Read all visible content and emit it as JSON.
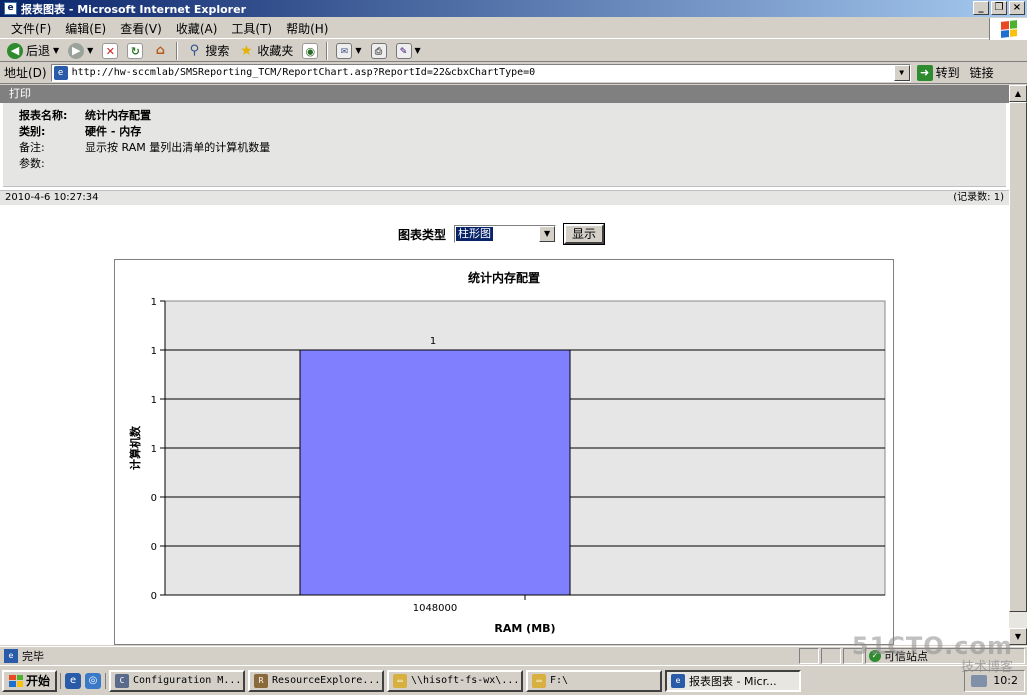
{
  "window": {
    "title": "报表图表 - Microsoft Internet Explorer"
  },
  "menu": [
    "文件(F)",
    "编辑(E)",
    "查看(V)",
    "收藏(A)",
    "工具(T)",
    "帮助(H)"
  ],
  "toolbar": {
    "back_label": "后退",
    "search_label": "搜索",
    "favorites_label": "收藏夹"
  },
  "address": {
    "label": "地址(D)",
    "url": "http://hw-sccmlab/SMSReporting_TCM/ReportChart.asp?ReportId=22&cbxChartType=0",
    "go_label": "转到",
    "links_label": "链接"
  },
  "report": {
    "print_label": "打印",
    "name_key": "报表名称:",
    "name_value": "统计内存配置",
    "category_key": "类别:",
    "category_value": "硬件 - 内存",
    "comment_key": "备注:",
    "comment_value": "显示按 RAM 量列出清单的计算机数量",
    "params_key": "参数:",
    "timestamp": "2010-4-6 10:27:34",
    "record_count": "(记录数: 1)",
    "chart_type_label": "图表类型",
    "chart_type_value": "柱形图",
    "show_button": "显示"
  },
  "chart_data": {
    "type": "bar",
    "title": "统计内存配置",
    "xlabel": "RAM (MB)",
    "ylabel": "计算机数",
    "categories": [
      "1048000"
    ],
    "values": [
      1
    ],
    "ytick_labels": [
      "0",
      "0",
      "0",
      "1",
      "1",
      "1",
      "1"
    ],
    "ylim": [
      0,
      1.2
    ],
    "data_labels": [
      "1"
    ],
    "grid": true,
    "plot_background": "#e6e6e6",
    "bar_color": "#8080ff",
    "legend": "none"
  },
  "status": {
    "text": "完毕",
    "zone": "可信站点"
  },
  "taskbar": {
    "start_label": "开始",
    "tasks": [
      {
        "label": "Configuration M...",
        "icon": "config-manager-icon"
      },
      {
        "label": "ResourceExplore...",
        "icon": "resource-explorer-icon"
      },
      {
        "label": "\\\\hisoft-fs-wx\\...",
        "icon": "folder-icon"
      },
      {
        "label": "F:\\",
        "icon": "folder-icon"
      },
      {
        "label": "报表图表 - Micr...",
        "icon": "ie-icon"
      }
    ],
    "clock": "10:2"
  },
  "watermark": {
    "line1": "51CTO.com",
    "line2": "技术博客"
  }
}
